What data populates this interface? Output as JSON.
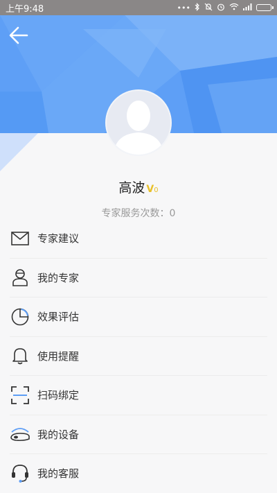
{
  "status_bar": {
    "time": "上午9:48",
    "dots": "•••"
  },
  "header": {
    "back_icon": "arrow-left-icon",
    "accent_color": "#5c9df5"
  },
  "profile": {
    "name": "高波",
    "vip_mark": "V",
    "vip_level": "0",
    "service_count_label": "专家服务次数",
    "service_count_separator": "：",
    "service_count_value": "0"
  },
  "menu": [
    {
      "label": "专家建议",
      "icon": "envelope-icon"
    },
    {
      "label": "我的专家",
      "icon": "expert-icon"
    },
    {
      "label": "效果评估",
      "icon": "pie-chart-icon"
    },
    {
      "label": "使用提醒",
      "icon": "bell-icon"
    },
    {
      "label": "扫码绑定",
      "icon": "scan-icon"
    },
    {
      "label": "我的设备",
      "icon": "device-icon"
    },
    {
      "label": "我的客服",
      "icon": "headset-icon"
    }
  ]
}
